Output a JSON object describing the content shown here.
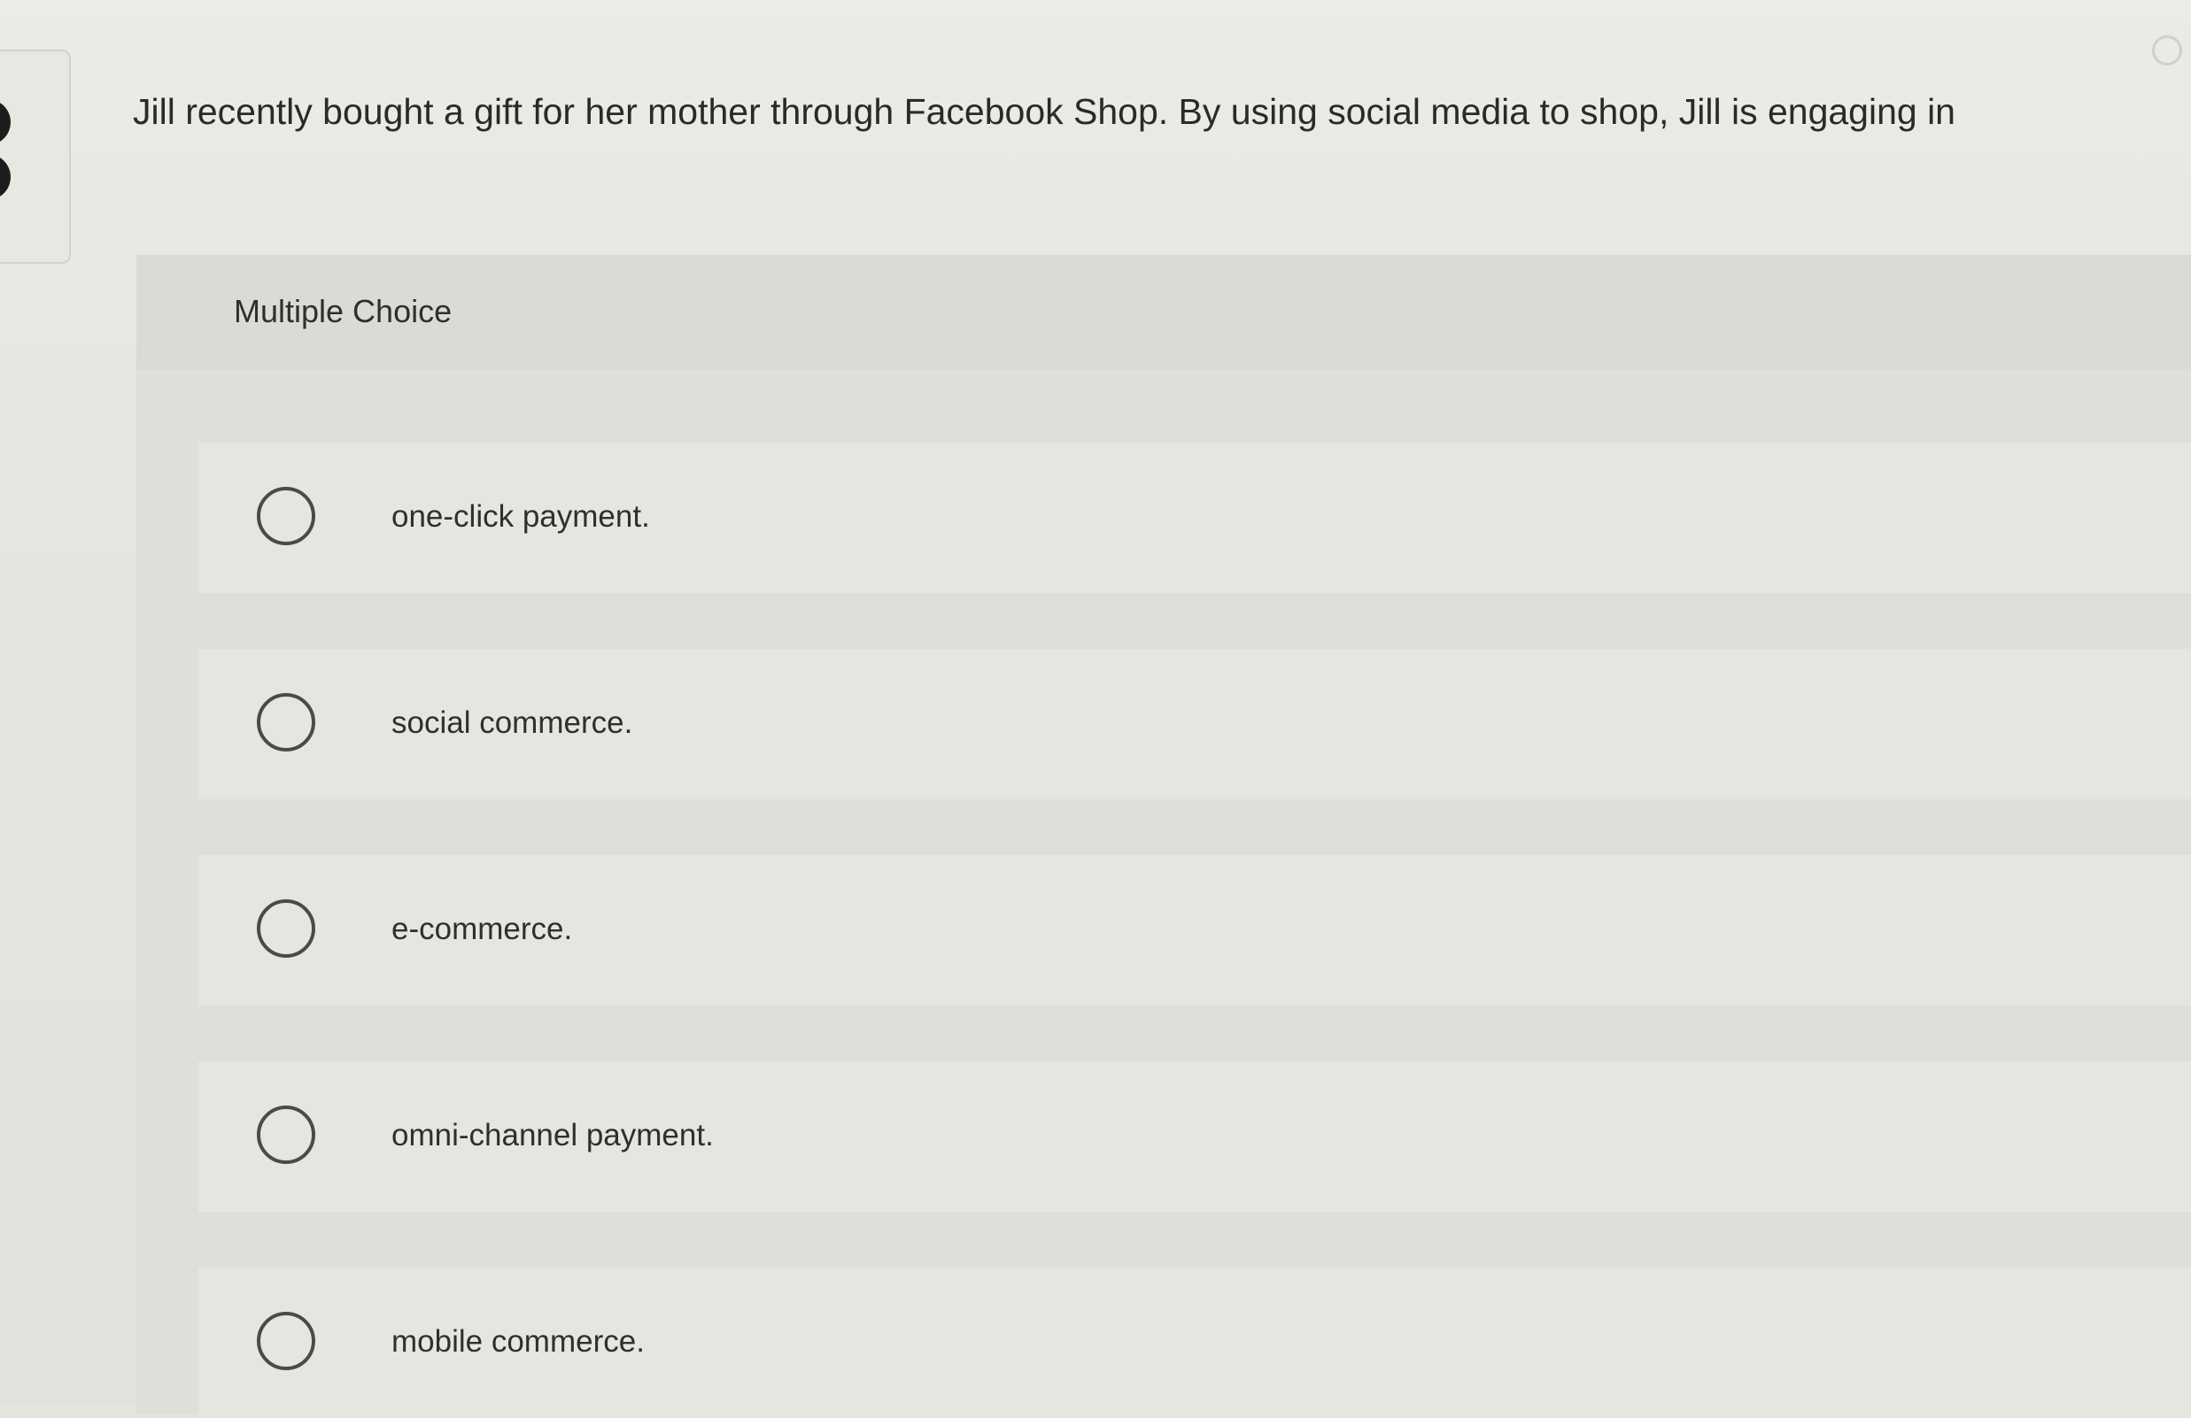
{
  "question": {
    "text": "Jill recently bought a gift for her mother through Facebook Shop. By using social media to shop, Jill is engaging in"
  },
  "choice_panel": {
    "title": "Multiple Choice",
    "options": [
      {
        "label": "one-click payment.",
        "selected": false
      },
      {
        "label": "social commerce.",
        "selected": false
      },
      {
        "label": "e-commerce.",
        "selected": false
      },
      {
        "label": "omni-channel payment.",
        "selected": false
      },
      {
        "label": "mobile commerce.",
        "selected": false
      }
    ]
  }
}
